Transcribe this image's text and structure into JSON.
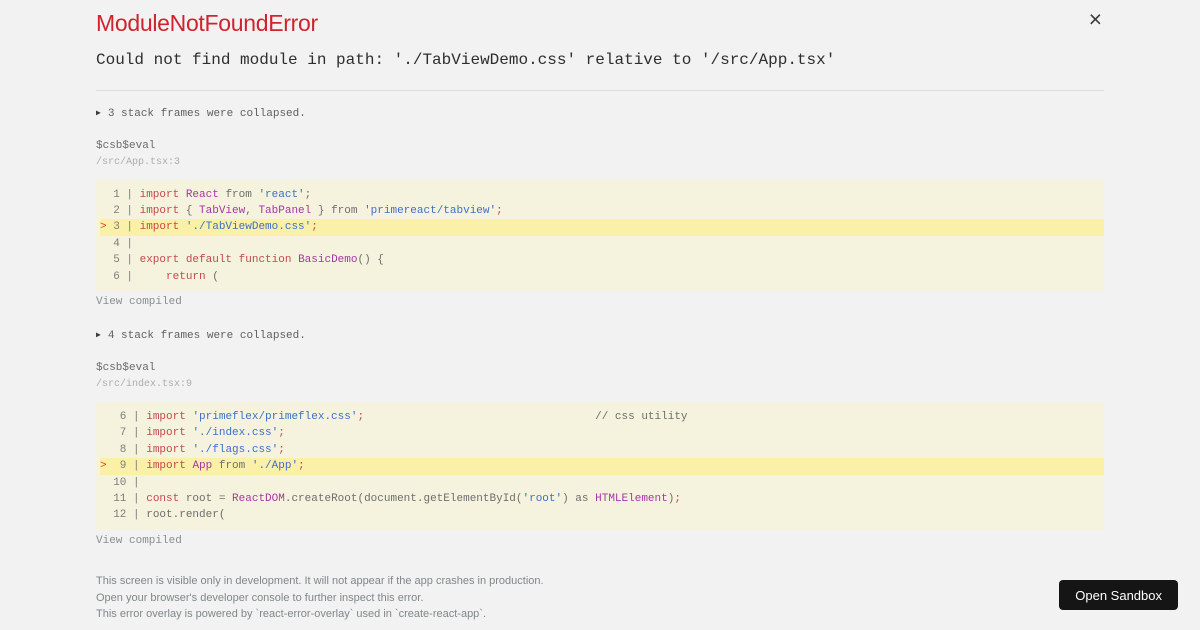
{
  "overlay": {
    "title": "ModuleNotFoundError",
    "message": "Could not find module in path: './TabViewDemo.css' relative to '/src/App.tsx'"
  },
  "icons": {
    "close": "×",
    "collapse": "▶"
  },
  "colors": {
    "page_bg": "#f2f2f2",
    "title_red": "#d0232e",
    "code_bg": "#f5f3de",
    "highlight_bg": "#fbf0a8",
    "keyword": "#c5494d",
    "identifier": "#a635a6",
    "string": "#3e6fc9",
    "plain": "#6e6e6e",
    "line_number": "#7d7d7d",
    "marker": "#e0432d",
    "muted_text": "#878e91",
    "button_bg": "#151515",
    "button_text": "#ffffff"
  },
  "sections": [
    {
      "collapsed_note": "3 stack frames were collapsed.",
      "frame_function": "$csb$eval",
      "frame_location": "/src/App.tsx:3",
      "view_compiled": "View compiled",
      "code": [
        {
          "hl": false,
          "tokens": [
            [
              "ln",
              "  1 | "
            ],
            [
              "kw",
              "import"
            ],
            [
              "pl",
              " "
            ],
            [
              "def",
              "React"
            ],
            [
              "pl",
              " from "
            ],
            [
              "str",
              "'react'"
            ],
            [
              "kw",
              ";"
            ]
          ]
        },
        {
          "hl": false,
          "tokens": [
            [
              "ln",
              "  2 | "
            ],
            [
              "kw",
              "import"
            ],
            [
              "pl",
              " { "
            ],
            [
              "def",
              "TabView"
            ],
            [
              "pl",
              ", "
            ],
            [
              "def",
              "TabPanel"
            ],
            [
              "pl",
              " } from "
            ],
            [
              "str",
              "'primereact/tabview'"
            ],
            [
              "kw",
              ";"
            ]
          ]
        },
        {
          "hl": true,
          "tokens": [
            [
              "mk",
              "> "
            ],
            [
              "ln",
              "3 | "
            ],
            [
              "kw",
              "import"
            ],
            [
              "pl",
              " "
            ],
            [
              "str",
              "'./TabViewDemo.css'"
            ],
            [
              "kw",
              ";"
            ]
          ]
        },
        {
          "hl": false,
          "tokens": [
            [
              "ln",
              "  4 | "
            ]
          ]
        },
        {
          "hl": false,
          "tokens": [
            [
              "ln",
              "  5 | "
            ],
            [
              "kw",
              "export"
            ],
            [
              "pl",
              " "
            ],
            [
              "kw",
              "default"
            ],
            [
              "pl",
              " "
            ],
            [
              "kw",
              "function"
            ],
            [
              "pl",
              " "
            ],
            [
              "def",
              "BasicDemo"
            ],
            [
              "pl",
              "() {"
            ]
          ]
        },
        {
          "hl": false,
          "tokens": [
            [
              "ln",
              "  6 | "
            ],
            [
              "pl",
              "    "
            ],
            [
              "kw",
              "return"
            ],
            [
              "pl",
              " ("
            ]
          ]
        }
      ]
    },
    {
      "collapsed_note": "4 stack frames were collapsed.",
      "frame_function": "$csb$eval",
      "frame_location": "/src/index.tsx:9",
      "view_compiled": "View compiled",
      "code": [
        {
          "hl": false,
          "tokens": [
            [
              "ln",
              "   6 | "
            ],
            [
              "kw",
              "import"
            ],
            [
              "pl",
              " "
            ],
            [
              "str",
              "'primeflex/primeflex.css'"
            ],
            [
              "kw",
              ";"
            ],
            [
              "cm",
              "                                   // css utility"
            ]
          ]
        },
        {
          "hl": false,
          "tokens": [
            [
              "ln",
              "   7 | "
            ],
            [
              "kw",
              "import"
            ],
            [
              "pl",
              " "
            ],
            [
              "str",
              "'./index.css'"
            ],
            [
              "kw",
              ";"
            ]
          ]
        },
        {
          "hl": false,
          "tokens": [
            [
              "ln",
              "   8 | "
            ],
            [
              "kw",
              "import"
            ],
            [
              "pl",
              " "
            ],
            [
              "str",
              "'./flags.css'"
            ],
            [
              "kw",
              ";"
            ]
          ]
        },
        {
          "hl": true,
          "tokens": [
            [
              "mk",
              "> "
            ],
            [
              "ln",
              " 9 | "
            ],
            [
              "kw",
              "import"
            ],
            [
              "pl",
              " "
            ],
            [
              "def",
              "App"
            ],
            [
              "pl",
              " from "
            ],
            [
              "str",
              "'./App'"
            ],
            [
              "kw",
              ";"
            ]
          ]
        },
        {
          "hl": false,
          "tokens": [
            [
              "ln",
              "  10 | "
            ]
          ]
        },
        {
          "hl": false,
          "tokens": [
            [
              "ln",
              "  11 | "
            ],
            [
              "kw",
              "const"
            ],
            [
              "pl",
              " root = "
            ],
            [
              "def",
              "ReactDOM"
            ],
            [
              "pl",
              ".createRoot(document.getElementById("
            ],
            [
              "str",
              "'root'"
            ],
            [
              "pl",
              ") as "
            ],
            [
              "def",
              "HTMLElement"
            ],
            [
              "pl",
              ")"
            ],
            [
              "kw",
              ";"
            ]
          ]
        },
        {
          "hl": false,
          "tokens": [
            [
              "ln",
              "  12 | "
            ],
            [
              "pl",
              "root.render("
            ]
          ]
        }
      ]
    }
  ],
  "footer": {
    "lines": [
      "This screen is visible only in development. It will not appear if the app crashes in production.",
      "Open your browser's developer console to further inspect this error.",
      "This error overlay is powered by `react-error-overlay` used in `create-react-app`."
    ],
    "button_label": "Open Sandbox"
  }
}
